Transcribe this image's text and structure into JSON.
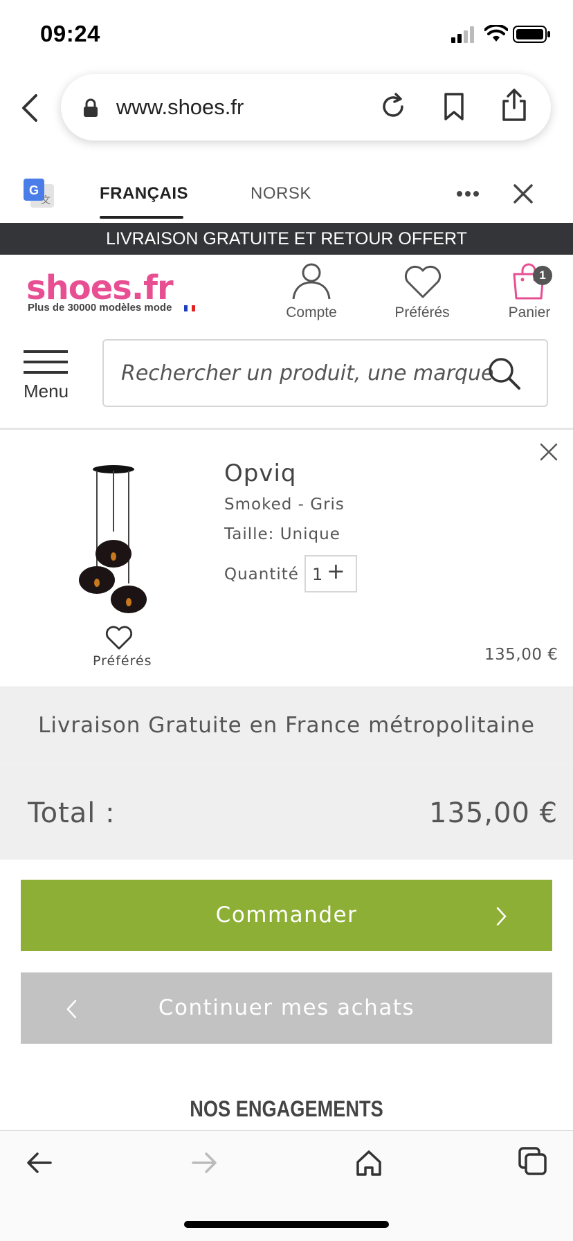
{
  "status_bar": {
    "time": "09:24"
  },
  "browser": {
    "url": "www.shoes.fr"
  },
  "translate_bar": {
    "lang_source": "FRANÇAIS",
    "lang_target": "NORSK"
  },
  "promo_banner": {
    "text": "LIVRAISON GRATUITE ET RETOUR OFFERT"
  },
  "header": {
    "logo": "shoes.fr",
    "tagline": "Plus de 30000 modèles mode",
    "account_label": "Compte",
    "favorites_label": "Préférés",
    "cart_label": "Panier",
    "cart_count": "1"
  },
  "search": {
    "menu_label": "Menu",
    "placeholder": "Rechercher un produit, une marque"
  },
  "cart_item": {
    "name": "Opviq",
    "color": "Smoked - Gris",
    "size": "Taille: Unique",
    "quantity_label": "Quantité",
    "quantity": "1",
    "favorite_label": "Préférés",
    "price": "135,00 €"
  },
  "summary": {
    "shipping_text": "Livraison Gratuite en France métropolitaine",
    "total_label": "Total :",
    "total_value": "135,00 €"
  },
  "actions": {
    "order_label": "Commander",
    "continue_label": "Continuer mes achats"
  },
  "section": {
    "engagements_title": "NOS ENGAGEMENTS"
  },
  "colors": {
    "brand_pink": "#e84f93",
    "order_green": "#8eaf36",
    "continue_grey": "#c2c2c2",
    "banner_dark": "#333538"
  }
}
